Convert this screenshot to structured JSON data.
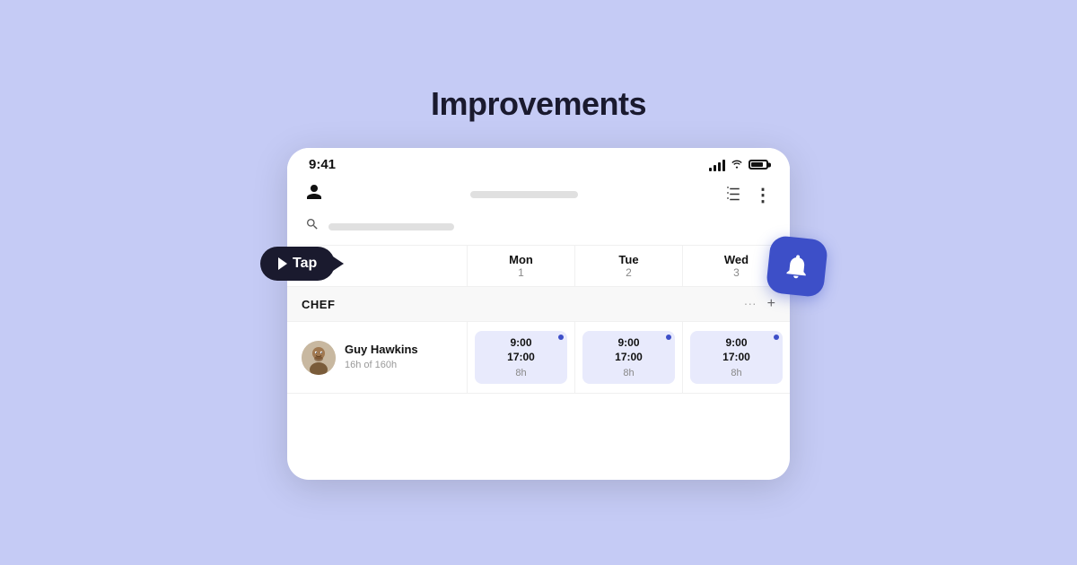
{
  "page": {
    "title": "Improvements",
    "background_color": "#c5cbf5"
  },
  "tap_bubble": {
    "label": "Tap"
  },
  "status_bar": {
    "time": "9:41"
  },
  "header": {
    "person_icon": "👤",
    "grid_icon": "⊞",
    "dots_icon": "⋮"
  },
  "days": [
    {
      "name": "Mon",
      "number": "1"
    },
    {
      "name": "Tue",
      "number": "2"
    },
    {
      "name": "Wed",
      "number": "3"
    }
  ],
  "section": {
    "label": "CHEF",
    "dots": "···",
    "add": "+"
  },
  "employee": {
    "name": "Guy Hawkins",
    "hours": "16h of 160h"
  },
  "shifts": [
    {
      "start": "9:00",
      "end": "17:00",
      "duration": "8h"
    },
    {
      "start": "9:00",
      "end": "17:00",
      "duration": "8h"
    },
    {
      "start": "9:00",
      "end": "17:00",
      "duration": "8h"
    }
  ]
}
